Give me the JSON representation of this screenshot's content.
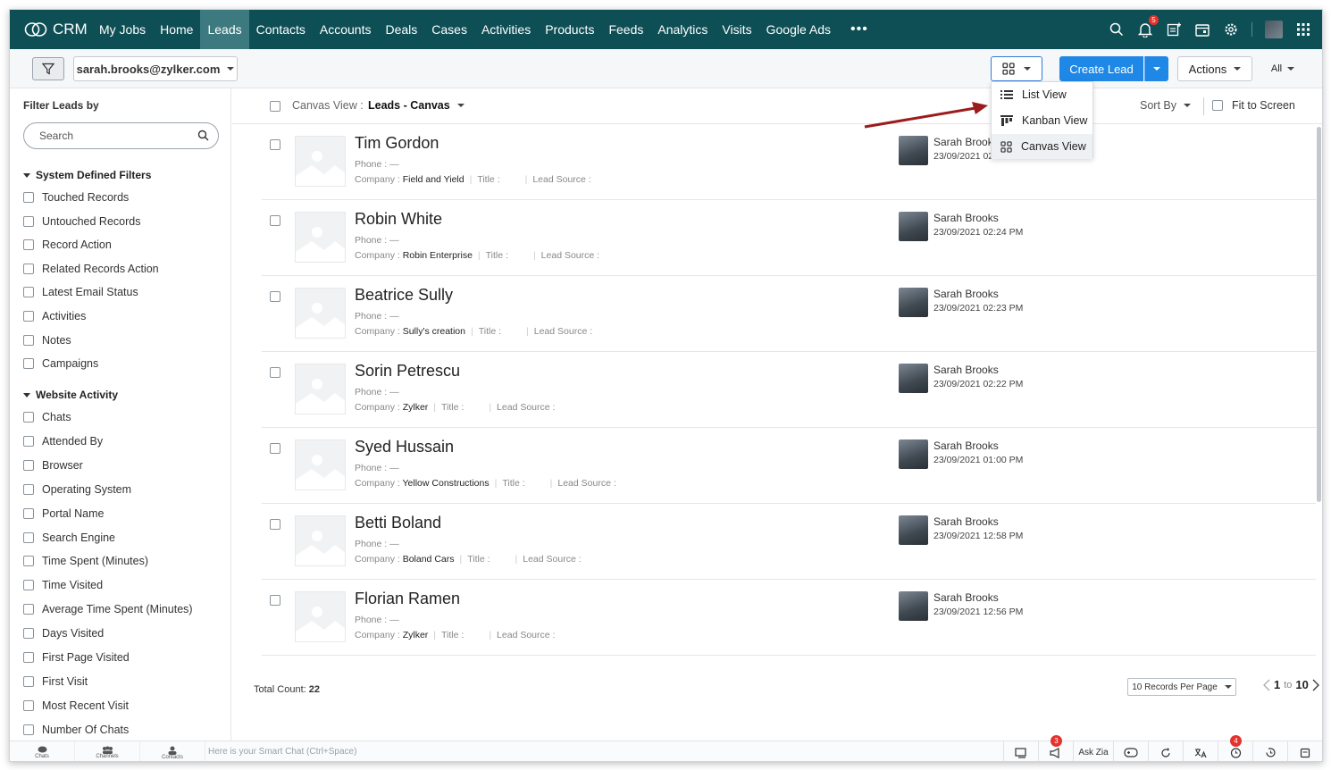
{
  "app": {
    "name": "CRM"
  },
  "nav": {
    "items": [
      "My Jobs",
      "Home",
      "Leads",
      "Contacts",
      "Accounts",
      "Deals",
      "Cases",
      "Activities",
      "Products",
      "Feeds",
      "Analytics",
      "Visits",
      "Google Ads"
    ],
    "active": "Leads",
    "more": "•••",
    "notification_count": "5"
  },
  "toolbar": {
    "user": "sarah.brooks@zylker.com",
    "create_label": "Create Lead",
    "actions_label": "Actions",
    "all_label": "All"
  },
  "view_menu": {
    "items": [
      {
        "label": "List View",
        "icon": "list-icon"
      },
      {
        "label": "Kanban View",
        "icon": "kanban-icon"
      },
      {
        "label": "Canvas View",
        "icon": "canvas-grid-icon"
      }
    ],
    "selected": "Canvas View"
  },
  "sidebar": {
    "title": "Filter Leads by",
    "search_placeholder": "Search",
    "system_title": "System Defined Filters",
    "system_filters": [
      "Touched Records",
      "Untouched Records",
      "Record Action",
      "Related Records Action",
      "Latest Email Status",
      "Activities",
      "Notes",
      "Campaigns"
    ],
    "website_title": "Website Activity",
    "website_filters": [
      "Chats",
      "Attended By",
      "Browser",
      "Operating System",
      "Portal Name",
      "Search Engine",
      "Time Spent (Minutes)",
      "Time Visited",
      "Average Time Spent (Minutes)",
      "Days Visited",
      "First Page Visited",
      "First Visit",
      "Most Recent Visit",
      "Number Of Chats"
    ]
  },
  "list": {
    "view_label": "Canvas View :",
    "view_name": "Leads - Canvas",
    "sort_label": "Sort By",
    "fit_label": "Fit to Screen",
    "phone_label": "Phone :",
    "phone_value": "—",
    "company_label": "Company :",
    "title_label": "Title :",
    "source_label": "Lead Source :",
    "records": [
      {
        "name": "Tim Gordon",
        "company": "Field and Yield",
        "owner": "Sarah Brooks",
        "date": "23/09/2021 02:26 PM"
      },
      {
        "name": "Robin White",
        "company": "Robin Enterprise",
        "owner": "Sarah Brooks",
        "date": "23/09/2021 02:24 PM"
      },
      {
        "name": "Beatrice Sully",
        "company": "Sully's creation",
        "owner": "Sarah Brooks",
        "date": "23/09/2021 02:23 PM"
      },
      {
        "name": "Sorin Petrescu",
        "company": "Zylker",
        "owner": "Sarah Brooks",
        "date": "23/09/2021 02:22 PM"
      },
      {
        "name": "Syed Hussain",
        "company": "Yellow Constructions",
        "owner": "Sarah Brooks",
        "date": "23/09/2021 01:00 PM"
      },
      {
        "name": "Betti Boland",
        "company": "Boland Cars",
        "owner": "Sarah Brooks",
        "date": "23/09/2021 12:58 PM"
      },
      {
        "name": "Florian Ramen",
        "company": "Zylker",
        "owner": "Sarah Brooks",
        "date": "23/09/2021 12:56 PM"
      }
    ],
    "total_label": "Total Count:",
    "total_value": "22",
    "per_page": "10 Records Per Page",
    "page_from": "1",
    "page_to_label": "to",
    "page_to": "10"
  },
  "bottom": {
    "tabs": [
      "Chats",
      "Channels",
      "Contacts"
    ],
    "chat_placeholder": "Here is your Smart Chat (Ctrl+Space)",
    "ask_zia": "Ask Zia",
    "announce_badge": "3",
    "alarm_badge": "4"
  },
  "colors": {
    "nav_bg": "#0e4f56",
    "primary": "#1f87e5",
    "arrow": "#9b1c1c"
  }
}
